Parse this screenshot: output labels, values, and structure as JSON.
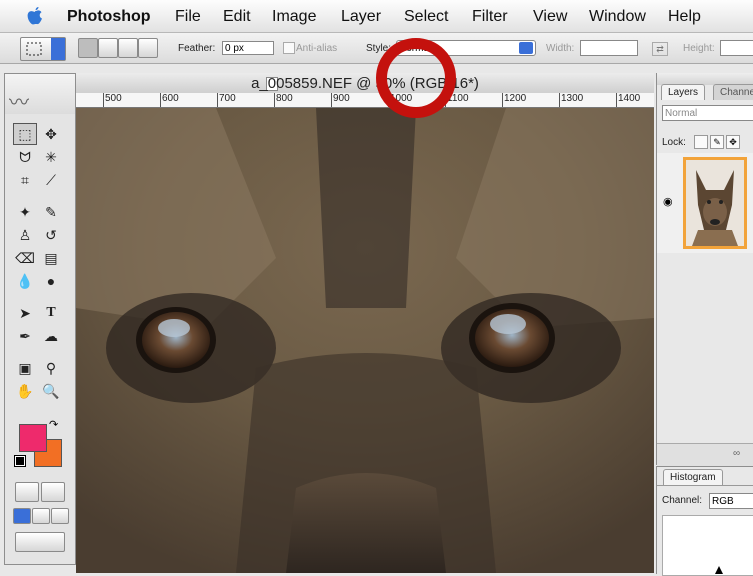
{
  "menubar": {
    "app_name": "Photoshop",
    "menus": [
      "File",
      "Edit",
      "Image",
      "Layer",
      "Select",
      "Filter",
      "View",
      "Window",
      "Help"
    ]
  },
  "options_bar": {
    "feather_label": "Feather:",
    "feather_value": "0 px",
    "antialias_label": "Anti-alias",
    "style_label": "Style:",
    "style_value": "Normal",
    "width_label": "Width:",
    "height_label": "Height:"
  },
  "document": {
    "title": "a_005859.NEF @ 50% (RGB/16*)",
    "ruler_labels": [
      "500",
      "600",
      "700",
      "800",
      "900",
      "1000",
      "1100",
      "1200",
      "1300",
      "1400"
    ]
  },
  "toolbox": {
    "foreground_color": "#ee2a6c",
    "background_color": "#f26f24"
  },
  "layers_panel": {
    "tabs": [
      "Layers",
      "Channels"
    ],
    "blend_mode": "Normal",
    "lock_label": "Lock:"
  },
  "histogram_panel": {
    "tab": "Histogram",
    "channel_label": "Channel:",
    "channel_value": "RGB"
  },
  "colors": {
    "highlight_circle": "#c4110d",
    "selected_layer_border": "#f2a33a"
  }
}
